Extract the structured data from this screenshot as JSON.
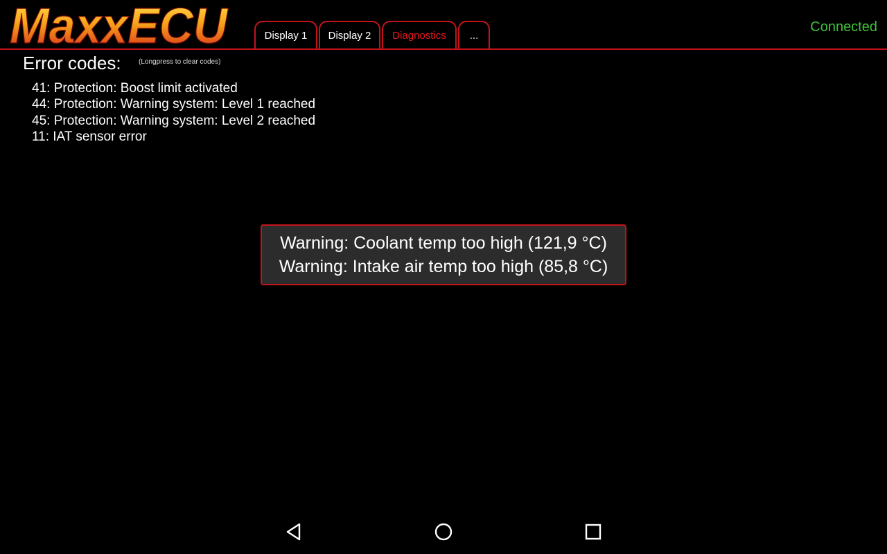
{
  "header": {
    "logo_text": "MaxxECU",
    "tabs": [
      {
        "label": "Display 1",
        "active": false
      },
      {
        "label": "Display 2",
        "active": false
      },
      {
        "label": "Diagnostics",
        "active": true
      },
      {
        "label": "...",
        "active": false
      }
    ],
    "status": "Connected"
  },
  "errors": {
    "title": "Error codes:",
    "hint": "(Longpress to clear codes)",
    "items": [
      "41: Protection: Boost limit activated",
      "44: Protection: Warning system: Level 1 reached",
      "45: Protection: Warning system: Level 2 reached",
      "11: IAT sensor error"
    ]
  },
  "warning": {
    "lines": [
      "Warning: Coolant temp too high (121,9 °C)",
      "Warning: Intake air temp too high (85,8 °C)"
    ]
  },
  "navbar": {
    "back_icon": "back-icon",
    "home_icon": "home-icon",
    "recents_icon": "recents-icon"
  },
  "colors": {
    "accent_red": "#c4141a",
    "active_tab_text": "#e8191f",
    "status_green": "#3ec13a",
    "popup_bg": "#2c2c2c"
  }
}
